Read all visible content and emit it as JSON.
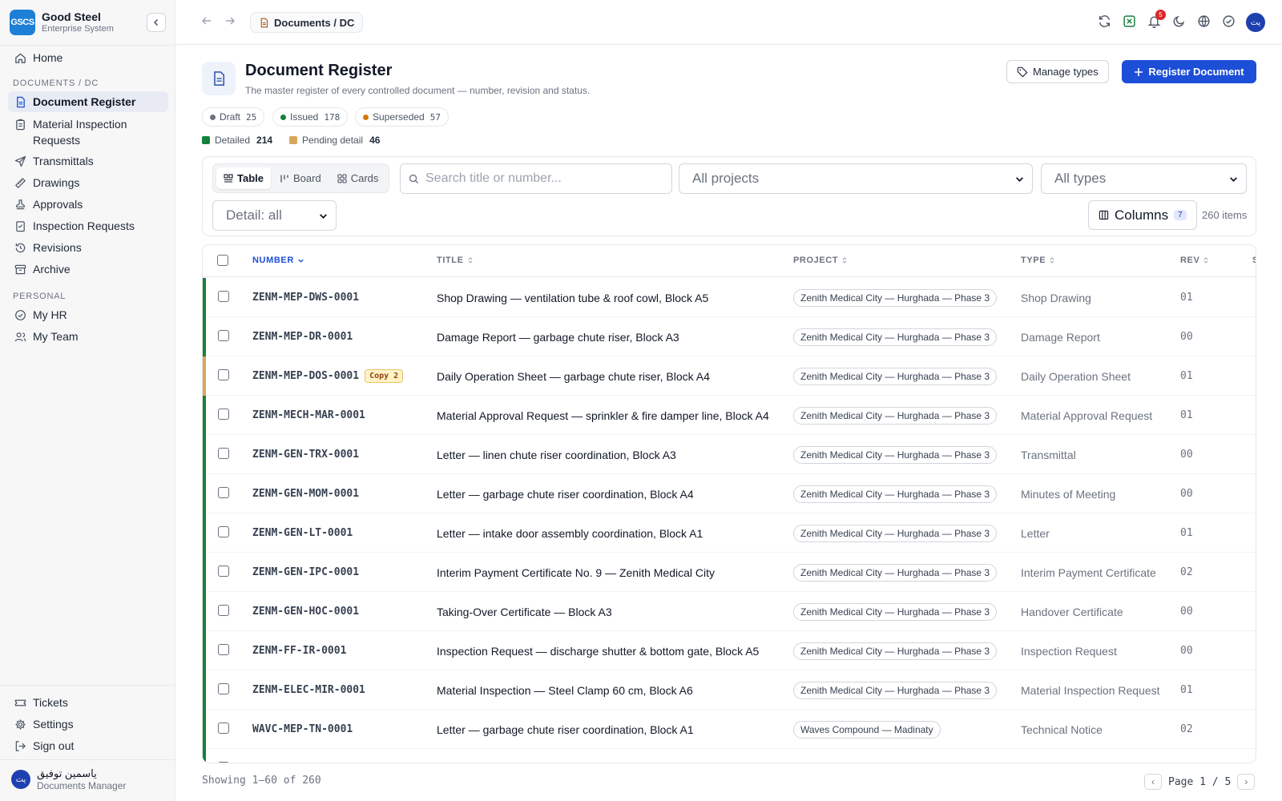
{
  "brand": {
    "logo_text": "GSCS",
    "name": "Good Steel",
    "subtitle": "Enterprise System"
  },
  "sidebar": {
    "home": "Home",
    "section_documents": "DOCUMENTS / DC",
    "doc_items": [
      {
        "label": "Document Register",
        "icon": "document-icon",
        "active": true
      },
      {
        "label": "Material Inspection Requests",
        "icon": "clipboard-icon"
      },
      {
        "label": "Transmittals",
        "icon": "send-icon"
      },
      {
        "label": "Drawings",
        "icon": "ruler-icon"
      },
      {
        "label": "Approvals",
        "icon": "stamp-icon"
      },
      {
        "label": "Inspection Requests",
        "icon": "checklist-icon"
      },
      {
        "label": "Revisions",
        "icon": "history-icon"
      },
      {
        "label": "Archive",
        "icon": "archive-icon"
      }
    ],
    "section_personal": "PERSONAL",
    "personal_items": [
      {
        "label": "My HR",
        "icon": "check-circle-icon"
      },
      {
        "label": "My Team",
        "icon": "users-icon"
      }
    ],
    "bottom_items": [
      {
        "label": "Tickets",
        "icon": "ticket-icon"
      },
      {
        "label": "Settings",
        "icon": "gear-icon"
      },
      {
        "label": "Sign out",
        "icon": "sign-out-icon"
      }
    ],
    "user": {
      "initials": "يت",
      "name": "ياسمين توفيق",
      "role": "Documents Manager"
    }
  },
  "topbar": {
    "breadcrumb": "Documents / DC",
    "notification_count": "5",
    "avatar_initials": "يت"
  },
  "header": {
    "title": "Document Register",
    "subtitle": "The master register of every controlled document — number, revision and status.",
    "manage_types_label": "Manage types",
    "register_label": "Register Document"
  },
  "status_chips": [
    {
      "label": "Draft",
      "count": "25",
      "color": "#6b7280"
    },
    {
      "label": "Issued",
      "count": "178",
      "color": "#15803d"
    },
    {
      "label": "Superseded",
      "count": "57",
      "color": "#d97706"
    }
  ],
  "detail_legend": [
    {
      "label": "Detailed",
      "count": "214",
      "color": "#15803d"
    },
    {
      "label": "Pending detail",
      "count": "46",
      "color": "#d6a75c"
    }
  ],
  "filters": {
    "views": [
      {
        "label": "Table",
        "icon": "table-icon",
        "active": true
      },
      {
        "label": "Board",
        "icon": "board-icon"
      },
      {
        "label": "Cards",
        "icon": "cards-icon"
      }
    ],
    "search_placeholder": "Search title or number...",
    "project_select": "All projects",
    "type_select": "All types",
    "detail_select": "Detail: all",
    "columns_label": "Columns",
    "columns_count": "7",
    "item_count": "260 items"
  },
  "table": {
    "headers": {
      "number": "NUMBER",
      "title": "TITLE",
      "project": "PROJECT",
      "type": "TYPE",
      "rev": "REV",
      "next": "S"
    },
    "rows": [
      {
        "number": "ZENM-MEP-DWS-0001",
        "badge": "",
        "title": "Shop Drawing — ventilation tube & roof cowl, Block A5",
        "project": "Zenith Medical City — Hurghada — Phase 3",
        "type": "Shop Drawing",
        "rev": "01",
        "bar_color": "#15803d"
      },
      {
        "number": "ZENM-MEP-DR-0001",
        "badge": "",
        "title": "Damage Report — garbage chute riser, Block A3",
        "project": "Zenith Medical City — Hurghada — Phase 3",
        "type": "Damage Report",
        "rev": "00",
        "bar_color": "#15803d"
      },
      {
        "number": "ZENM-MEP-DOS-0001",
        "badge": "Copy 2",
        "title": "Daily Operation Sheet — garbage chute riser, Block A4",
        "project": "Zenith Medical City — Hurghada — Phase 3",
        "type": "Daily Operation Sheet",
        "rev": "01",
        "bar_color": "#d6a75c"
      },
      {
        "number": "ZENM-MECH-MAR-0001",
        "badge": "",
        "title": "Material Approval Request — sprinkler & fire damper line, Block A4",
        "project": "Zenith Medical City — Hurghada — Phase 3",
        "type": "Material Approval Request",
        "rev": "01",
        "bar_color": "#15803d"
      },
      {
        "number": "ZENM-GEN-TRX-0001",
        "badge": "",
        "title": "Letter — linen chute riser coordination, Block A3",
        "project": "Zenith Medical City — Hurghada — Phase 3",
        "type": "Transmittal",
        "rev": "00",
        "bar_color": "#15803d"
      },
      {
        "number": "ZENM-GEN-MOM-0001",
        "badge": "",
        "title": "Letter — garbage chute riser coordination, Block A4",
        "project": "Zenith Medical City — Hurghada — Phase 3",
        "type": "Minutes of Meeting",
        "rev": "00",
        "bar_color": "#15803d"
      },
      {
        "number": "ZENM-GEN-LT-0001",
        "badge": "",
        "title": "Letter — intake door assembly coordination, Block A1",
        "project": "Zenith Medical City — Hurghada — Phase 3",
        "type": "Letter",
        "rev": "01",
        "bar_color": "#15803d"
      },
      {
        "number": "ZENM-GEN-IPC-0001",
        "badge": "",
        "title": "Interim Payment Certificate No. 9 — Zenith Medical City",
        "project": "Zenith Medical City — Hurghada — Phase 3",
        "type": "Interim Payment Certificate",
        "rev": "02",
        "bar_color": "#15803d"
      },
      {
        "number": "ZENM-GEN-HOC-0001",
        "badge": "",
        "title": "Taking-Over Certificate — Block A3",
        "project": "Zenith Medical City — Hurghada — Phase 3",
        "type": "Handover Certificate",
        "rev": "00",
        "bar_color": "#15803d"
      },
      {
        "number": "ZENM-FF-IR-0001",
        "badge": "",
        "title": "Inspection Request — discharge shutter & bottom gate, Block A5",
        "project": "Zenith Medical City — Hurghada — Phase 3",
        "type": "Inspection Request",
        "rev": "00",
        "bar_color": "#15803d"
      },
      {
        "number": "ZENM-ELEC-MIR-0001",
        "badge": "",
        "title": "Material Inspection — Steel Clamp 60 cm, Block A6",
        "project": "Zenith Medical City — Hurghada — Phase 3",
        "type": "Material Inspection Request",
        "rev": "01",
        "bar_color": "#15803d"
      },
      {
        "number": "WAVC-MEP-TN-0001",
        "badge": "",
        "title": "Letter — garbage chute riser coordination, Block A1",
        "project": "Waves Compound — Madinaty",
        "type": "Technical Notice",
        "rev": "02",
        "bar_color": "#15803d"
      }
    ]
  },
  "footer": {
    "showing": "Showing 1–60 of 260",
    "page_label": "Page 1 / 5",
    "prev": "‹",
    "next": "›"
  }
}
